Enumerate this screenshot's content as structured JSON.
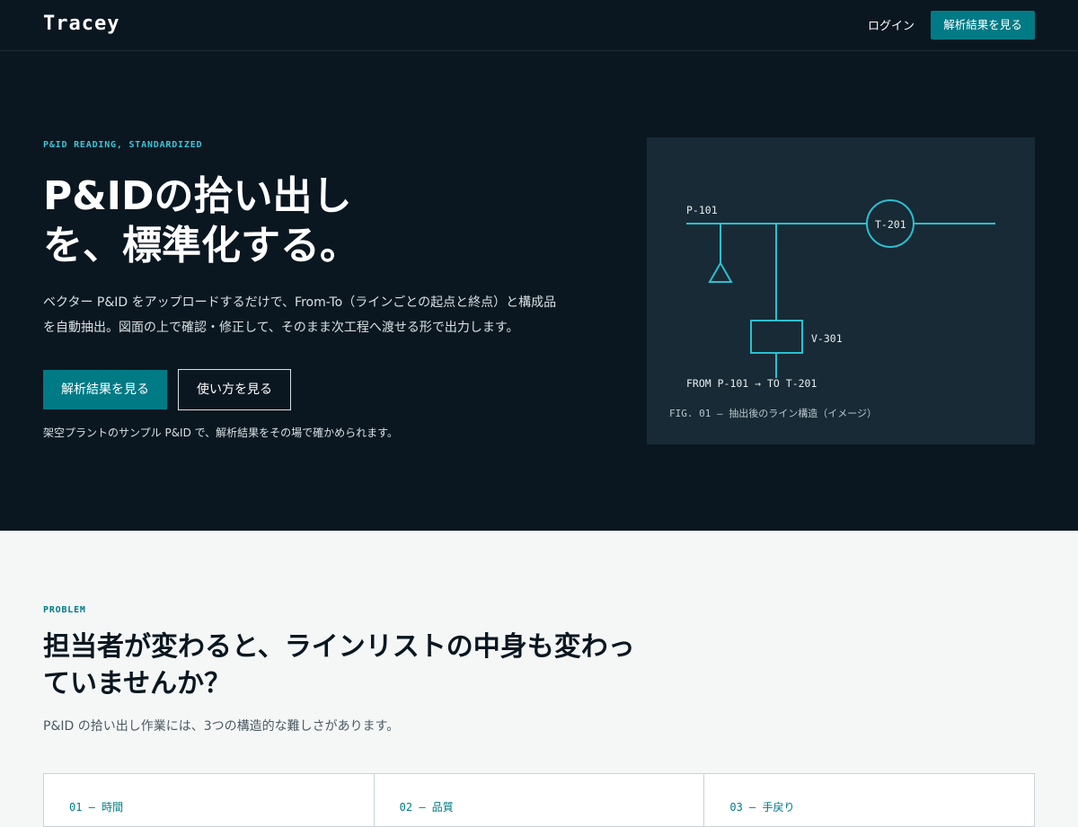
{
  "header": {
    "logo": "Tracey",
    "login": "ログイン",
    "cta": "解析結果を見る"
  },
  "hero": {
    "eyebrow": "P&ID READING, STANDARDIZED",
    "title_line1": "P&IDの拾い出し",
    "title_line2": "を、標準化する。",
    "desc_line1": "ベクター P&ID をアップロードするだけで、From-To（ラインごとの起点と終点）と構成品",
    "desc_line2": "を自動抽出。図面の上で確認・修正して、そのまま次工程へ渡せる形で出力します。",
    "primary_button": "解析結果を見る",
    "secondary_button": "使い方を見る",
    "note": "架空プラントのサンプル P&ID で、解析結果をその場で確かめられます。"
  },
  "figure": {
    "label_p101": "P-101",
    "label_t201": "T-201",
    "label_v301": "V-301",
    "from_to": "FROM P-101 → TO T-201",
    "caption": "FIG. 01 — 抽出後のライン構造（イメージ）",
    "line_color": "#2bbfd0"
  },
  "problem": {
    "eyebrow": "PROBLEM",
    "title_line1": "担当者が変わると、ラインリストの中身も変わっ",
    "title_line2": "ていませんか？",
    "subtitle": "P&ID の拾い出し作業には、3つの構造的な難しさがあります。",
    "cards": [
      {
        "label": "01 — 時間"
      },
      {
        "label": "02 — 品質"
      },
      {
        "label": "03 — 手戻り"
      }
    ]
  },
  "colors": {
    "dark_bg": "#0b1720",
    "accent": "#007a85",
    "panel": "#172a35",
    "eyebrow": "#3fc3d6"
  }
}
